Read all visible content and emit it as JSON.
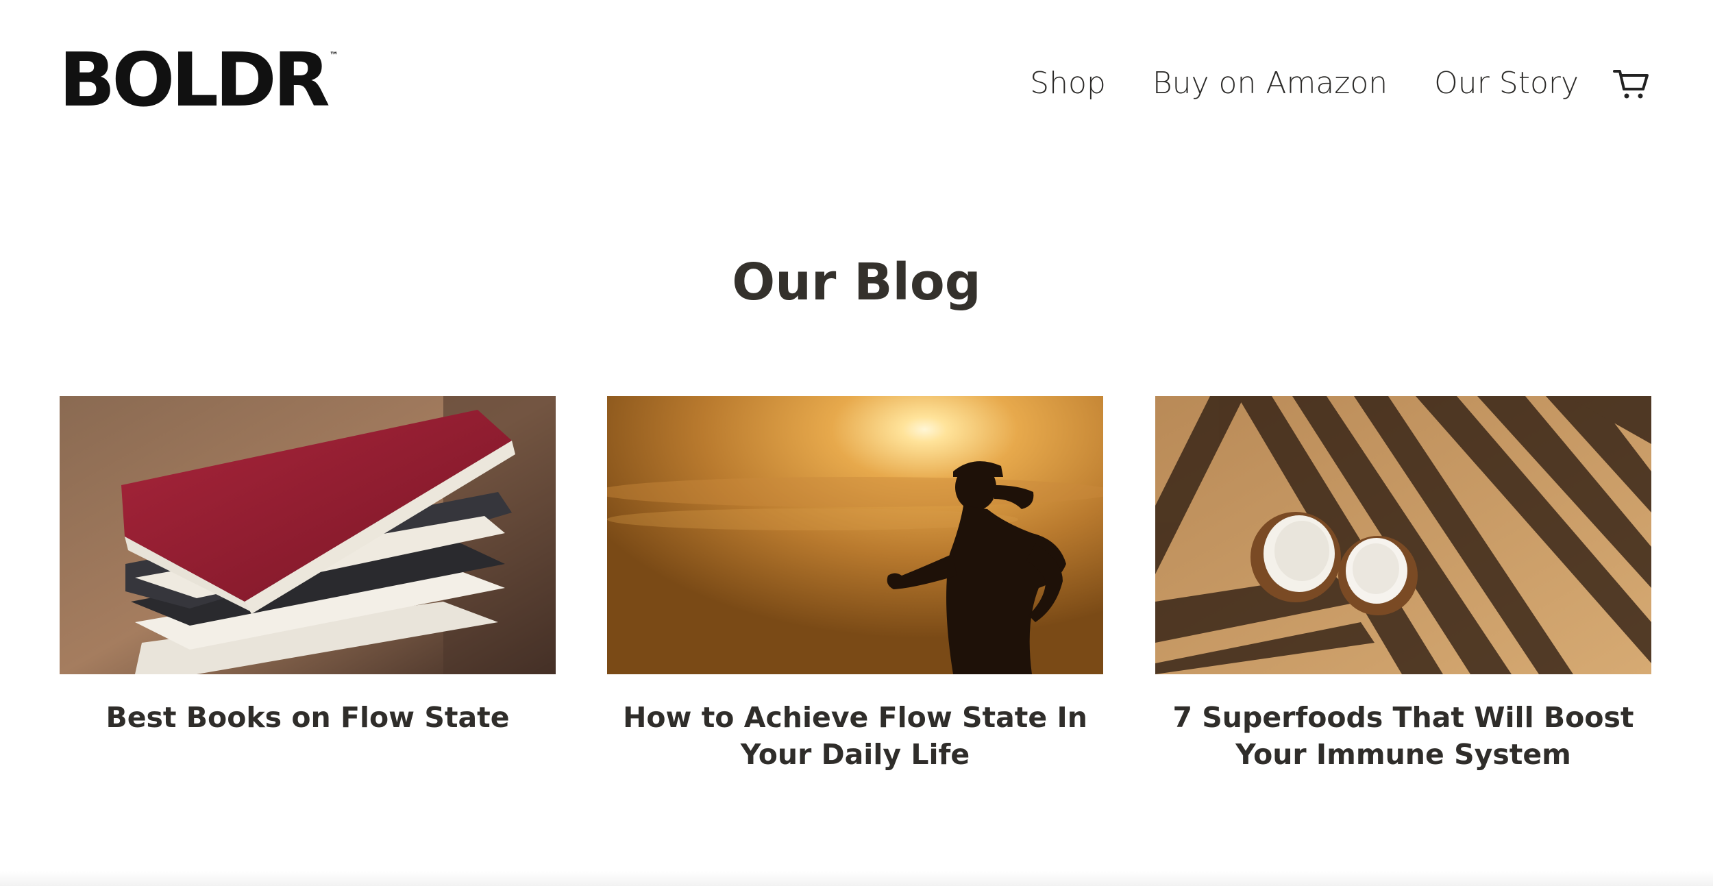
{
  "brand": {
    "name": "BOLDR",
    "trademark": "™"
  },
  "nav": {
    "items": [
      {
        "label": "Shop"
      },
      {
        "label": "Buy on Amazon"
      },
      {
        "label": "Our Story"
      }
    ],
    "cart_icon": "cart-icon"
  },
  "page": {
    "title": "Our Blog"
  },
  "posts": [
    {
      "title": "Best Books on Flow State",
      "image": "stack-of-books"
    },
    {
      "title": "How to Achieve Flow State In Your Daily Life",
      "image": "runner-silhouette-sunset"
    },
    {
      "title": "7 Superfoods That Will Boost Your Immune System",
      "image": "coconuts-on-sand"
    }
  ],
  "colors": {
    "text": "#2f2d2a",
    "logo": "#111111",
    "background": "#ffffff"
  }
}
